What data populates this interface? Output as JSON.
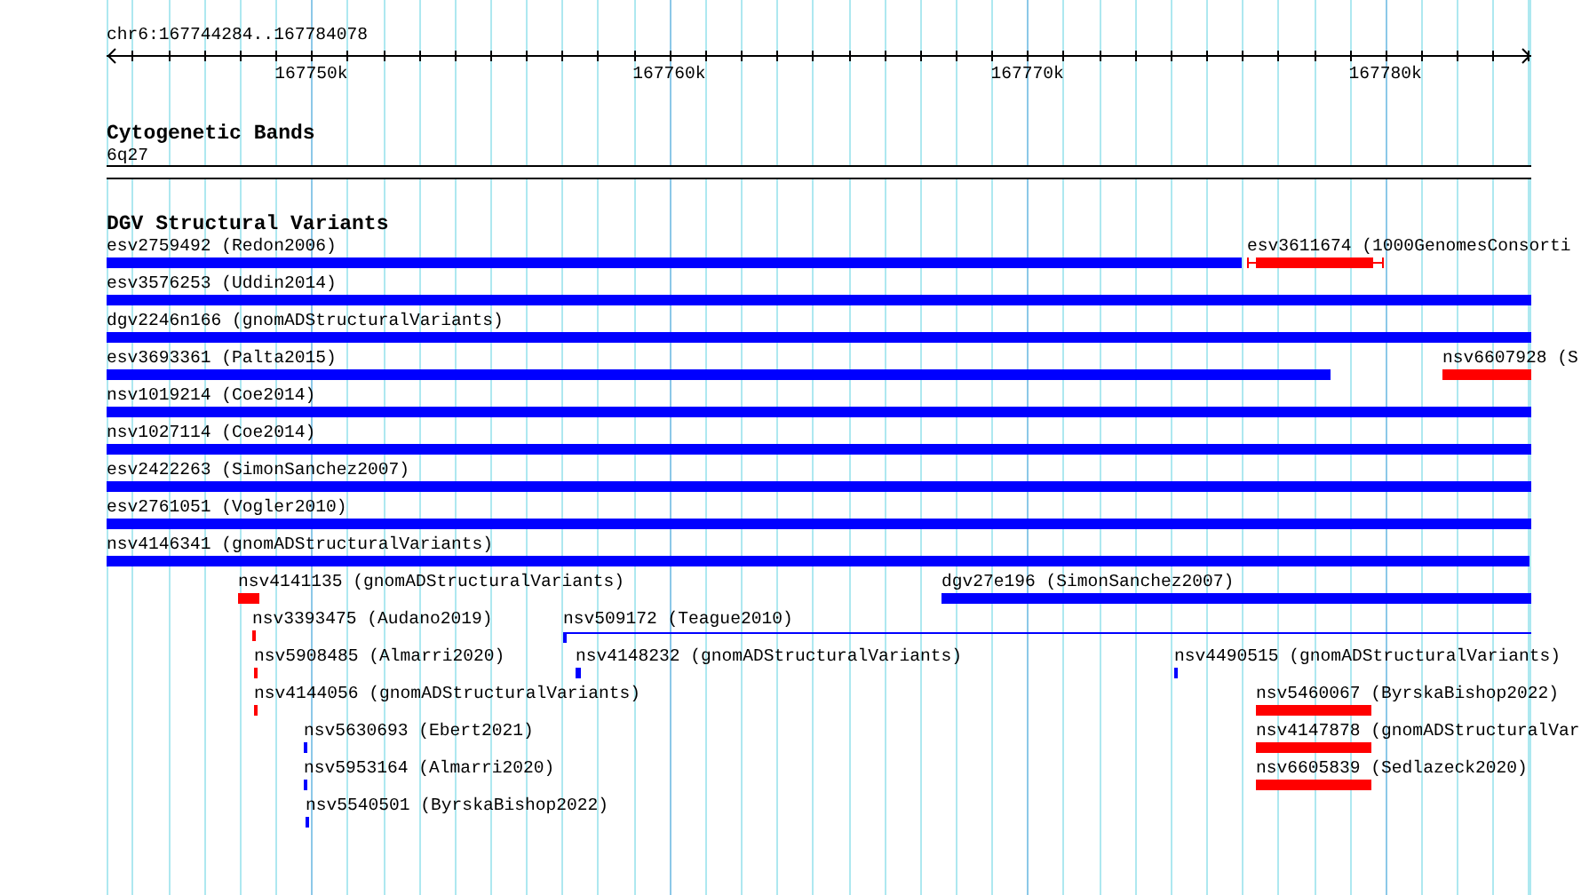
{
  "region": {
    "label": "chr6:167744284..167784078"
  },
  "ruler": {
    "labels": [
      "167750k",
      "167760k",
      "167770k",
      "167780k"
    ]
  },
  "cytoband_track": {
    "title": "Cytogenetic Bands",
    "band": "6q27"
  },
  "variant_track": {
    "title": "DGV Structural Variants",
    "rows": [
      {
        "features": [
          {
            "label": "esv2759492 (Redon2006)",
            "kind": "bar",
            "color": "#0000ff"
          },
          {
            "label": "esv3611674 (1000GenomesConsorti",
            "kind": "whiskered",
            "color": "#ff0000"
          }
        ]
      },
      {
        "features": [
          {
            "label": "esv3576253 (Uddin2014)",
            "kind": "bar",
            "color": "#0000ff"
          }
        ]
      },
      {
        "features": [
          {
            "label": "dgv2246n166 (gnomADStructuralVariants)",
            "kind": "bar",
            "color": "#0000ff"
          }
        ]
      },
      {
        "features": [
          {
            "label": "esv3693361 (Palta2015)",
            "kind": "bar",
            "color": "#0000ff"
          },
          {
            "label": "nsv6607928 (S",
            "kind": "bar",
            "color": "#ff0000"
          }
        ]
      },
      {
        "features": [
          {
            "label": "nsv1019214 (Coe2014)",
            "kind": "bar",
            "color": "#0000ff"
          }
        ]
      },
      {
        "features": [
          {
            "label": "nsv1027114 (Coe2014)",
            "kind": "bar",
            "color": "#0000ff"
          }
        ]
      },
      {
        "features": [
          {
            "label": "esv2422263 (SimonSanchez2007)",
            "kind": "bar",
            "color": "#0000ff"
          }
        ]
      },
      {
        "features": [
          {
            "label": "esv2761051 (Vogler2010)",
            "kind": "bar",
            "color": "#0000ff"
          }
        ]
      },
      {
        "features": [
          {
            "label": "nsv4146341 (gnomADStructuralVariants)",
            "kind": "bar",
            "color": "#0000ff"
          }
        ]
      },
      {
        "features": [
          {
            "label": "nsv4141135 (gnomADStructuralVariants)",
            "kind": "bar",
            "color": "#ff0000"
          },
          {
            "label": "dgv27e196 (SimonSanchez2007)",
            "kind": "bar",
            "color": "#0000ff"
          }
        ]
      },
      {
        "features": [
          {
            "label": "nsv3393475 (Audano2019)",
            "kind": "bar",
            "color": "#ff0000"
          },
          {
            "label": "nsv509172 (Teague2010)",
            "kind": "line",
            "color": "#0000ff"
          }
        ]
      },
      {
        "features": [
          {
            "label": "nsv5908485 (Almarri2020)",
            "kind": "bar",
            "color": "#ff0000"
          },
          {
            "label": "nsv4148232 (gnomADStructuralVariants)",
            "kind": "bar",
            "color": "#0000ff"
          },
          {
            "label": "nsv4490515 (gnomADStructuralVariants)",
            "kind": "bar",
            "color": "#0000ff"
          }
        ]
      },
      {
        "features": [
          {
            "label": "nsv4144056 (gnomADStructuralVariants)",
            "kind": "bar",
            "color": "#ff0000"
          },
          {
            "label": "nsv5460067 (ByrskaBishop2022)",
            "kind": "bar",
            "color": "#ff0000"
          }
        ]
      },
      {
        "features": [
          {
            "label": "nsv5630693 (Ebert2021)",
            "kind": "bar",
            "color": "#0000ff"
          },
          {
            "label": "nsv4147878 (gnomADStructuralVar",
            "kind": "bar",
            "color": "#ff0000"
          }
        ]
      },
      {
        "features": [
          {
            "label": "nsv5953164 (Almarri2020)",
            "kind": "bar",
            "color": "#0000ff"
          },
          {
            "label": "nsv6605839 (Sedlazeck2020)",
            "kind": "bar",
            "color": "#ff0000"
          }
        ]
      },
      {
        "features": [
          {
            "label": "nsv5540501 (ByrskaBishop2022)",
            "kind": "bar",
            "color": "#0000ff"
          }
        ]
      }
    ]
  }
}
